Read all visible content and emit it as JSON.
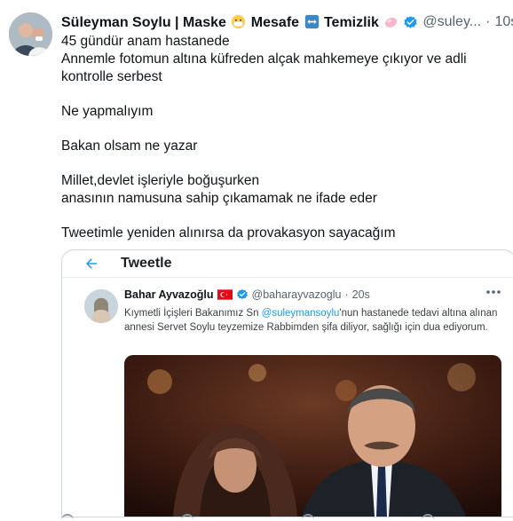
{
  "tweet": {
    "author_name_parts": [
      "Süleyman Soylu | Maske",
      "Mesafe",
      "Temizlik"
    ],
    "emoji_names": [
      "mask-face-emoji",
      "left-right-arrow-emoji",
      "soap-emoji"
    ],
    "handle": "@suley...",
    "dot_sep": "·",
    "time": "10s",
    "lines": [
      "45 gündür anam hastanede",
      "Annemle fotomun altına küfreden alçak mahkemeye çıkıyor ve adli kontrolle serbest",
      "",
      "Ne yapmalıyım",
      "",
      "Bakan olsam ne yazar",
      "",
      "Millet,devlet işleriyle boğuşurken",
      "anasının namusuna sahip çıkamamak ne ifade eder",
      "",
      "Tweetimle yeniden alınırsa da provakasyon sayacağım"
    ]
  },
  "embed": {
    "title": "Tweetle",
    "quoted": {
      "name": "Bahar Ayvazoğlu",
      "handle": "@baharayvazoglu",
      "dot_sep": "·",
      "time": "20s",
      "text_before": "Kıymetli İçişleri Bakanımız Sn ",
      "mention": "@suleymansoylu",
      "text_after": "'nun hastanede tedavi altına alınan annesi Servet Soylu teyzemize Rabbimden şifa diliyor, sağlığı için dua ediyorum."
    }
  },
  "colors": {
    "accent": "#1d9bf0",
    "secondary_text": "#536471",
    "flag_red": "#e30a17"
  }
}
